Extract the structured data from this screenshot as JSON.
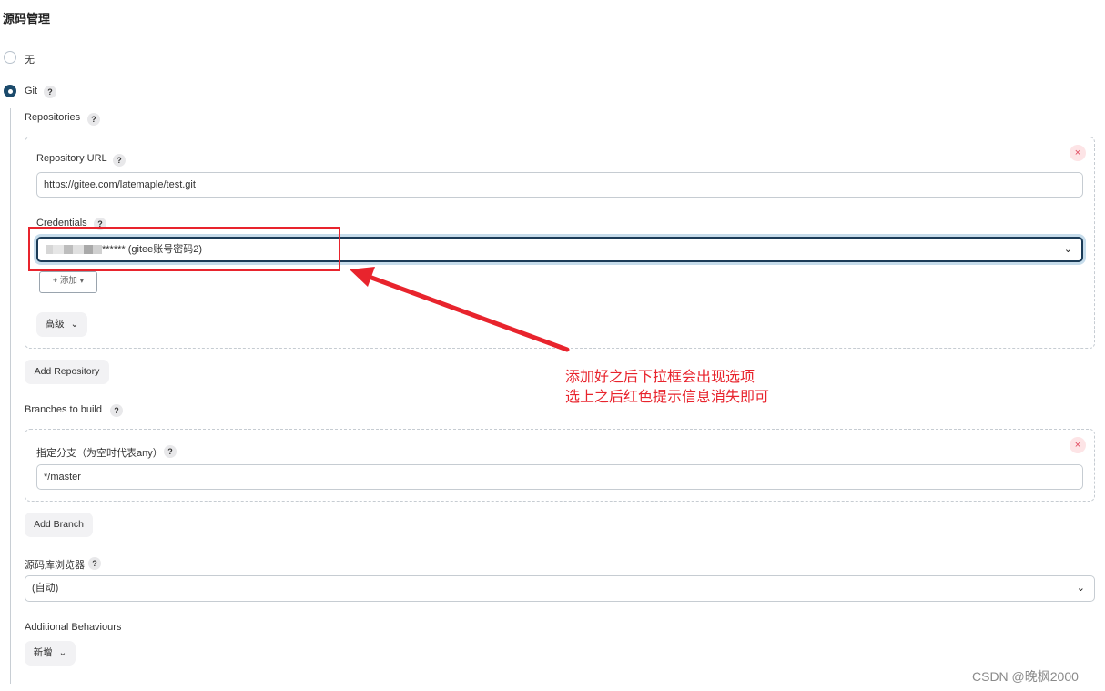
{
  "section_title": "源码管理",
  "scm_options": [
    {
      "label": "无",
      "selected": false
    },
    {
      "label": "Git",
      "selected": true,
      "help": "?"
    }
  ],
  "repositories": {
    "label": "Repositories",
    "help": "?",
    "repo_url": {
      "label": "Repository URL",
      "help": "?",
      "value": "https://gitee.com/latemaple/test.git"
    },
    "credentials": {
      "label": "Credentials",
      "help": "?",
      "value_suffix": "****** (gitee账号密码2)"
    },
    "add_button": "+ 添加 ▾",
    "advanced_button": "高级",
    "remove_icon": "×"
  },
  "add_repository_button": "Add Repository",
  "branches": {
    "label": "Branches to build",
    "help": "?",
    "branch_spec_label": "指定分支（为空时代表any）",
    "branch_spec_help": "?",
    "branch_spec_value": "*/master",
    "remove_icon": "×"
  },
  "add_branch_button": "Add Branch",
  "repo_browser": {
    "label": "源码库浏览器",
    "help": "?",
    "value": "(自动)"
  },
  "additional_behaviours": {
    "label": "Additional Behaviours",
    "button": "新增"
  },
  "annotation": {
    "line1": "添加好之后下拉框会出现选项",
    "line2": "选上之后红色提示信息消失即可",
    "color": "#e8242d"
  },
  "watermark": "CSDN @晚枫2000"
}
